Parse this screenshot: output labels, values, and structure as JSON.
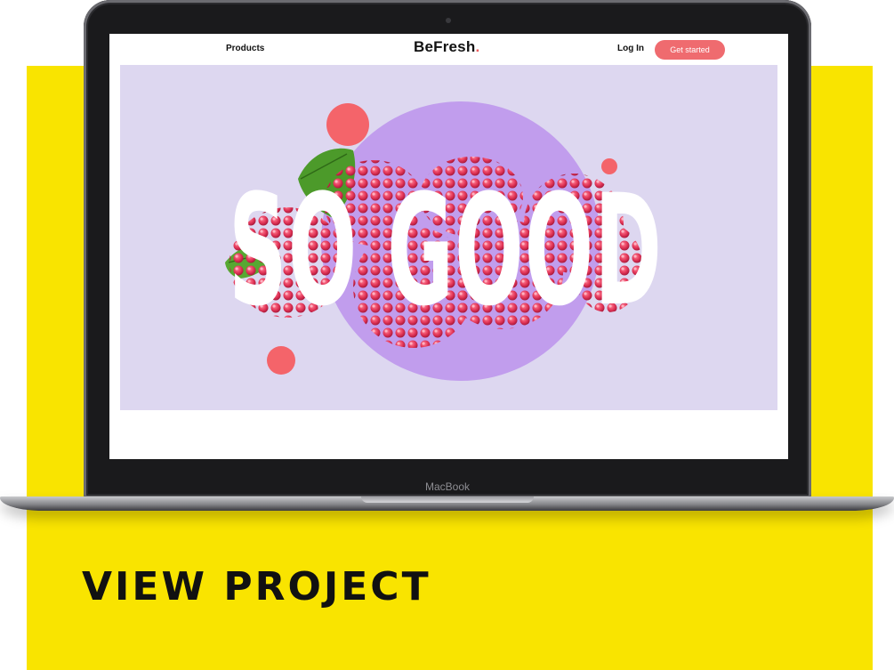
{
  "app": {
    "brand_name": "BeFresh",
    "brand_dot": ".",
    "device_label": "MacBook"
  },
  "nav": {
    "products_label": "Products",
    "login_label": "Log In",
    "cta_label": "Get started"
  },
  "hero": {
    "headline": "SO GOOD",
    "image_subject": "raspberries-with-leaf"
  },
  "footer": {
    "view_project_label": "VIEW PROJECT"
  },
  "colors": {
    "card_yellow": "#f9e400",
    "hero_background": "#ddd7f0",
    "hero_circle": "#c19ded",
    "accent_red": "#ef6b6f",
    "headline_white": "#ffffff"
  }
}
